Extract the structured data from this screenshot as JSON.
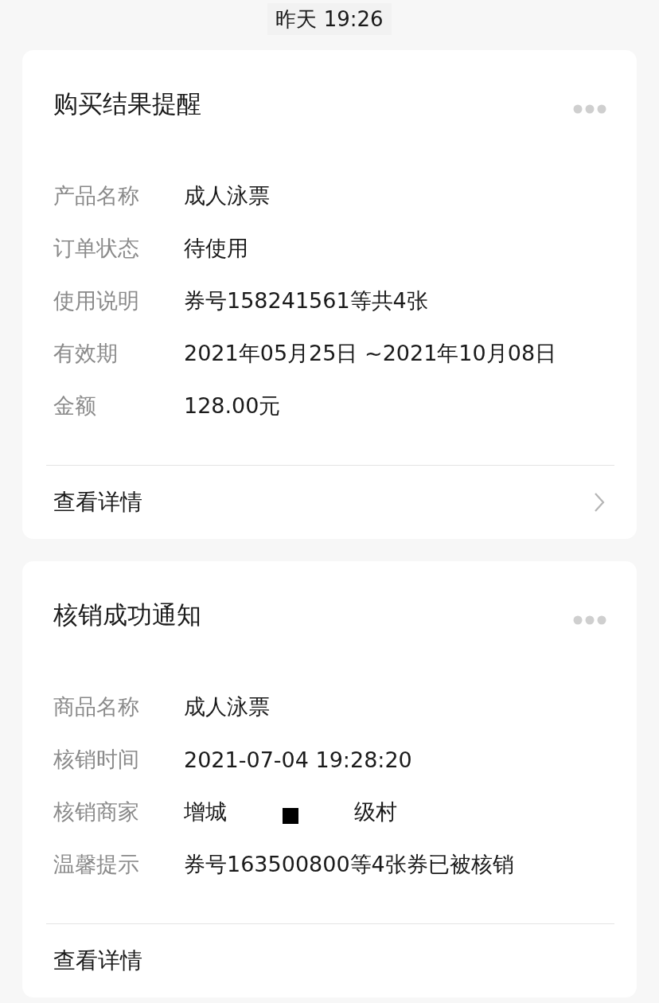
{
  "timestamp": "昨天 19:26",
  "cards": [
    {
      "title": "购买结果提醒",
      "rows": [
        {
          "label": "产品名称",
          "parts": [
            "成人泳票"
          ]
        },
        {
          "label": "订单状态",
          "parts": [
            "待使用"
          ]
        },
        {
          "label": "使用说明",
          "parts": [
            "券号158241561等共4张"
          ]
        },
        {
          "label": "有效期",
          "parts": [
            "2021年05月25日 ~2021年10月08日"
          ]
        },
        {
          "label": "金额",
          "parts": [
            "128.00元"
          ]
        }
      ],
      "footer": "查看详情",
      "chevron": true
    },
    {
      "title": "核销成功通知",
      "rows": [
        {
          "label": "商品名称",
          "parts": [
            "成人泳票"
          ]
        },
        {
          "label": "核销时间",
          "parts": [
            "2021-07-04 19:28:20"
          ]
        },
        {
          "label": "核销商家",
          "parts": [
            "增城",
            "级村"
          ]
        },
        {
          "label": "温馨提示",
          "parts": [
            "券号163500800等4张券已被核销"
          ]
        }
      ],
      "footer": "查看详情",
      "chevron": false
    }
  ]
}
